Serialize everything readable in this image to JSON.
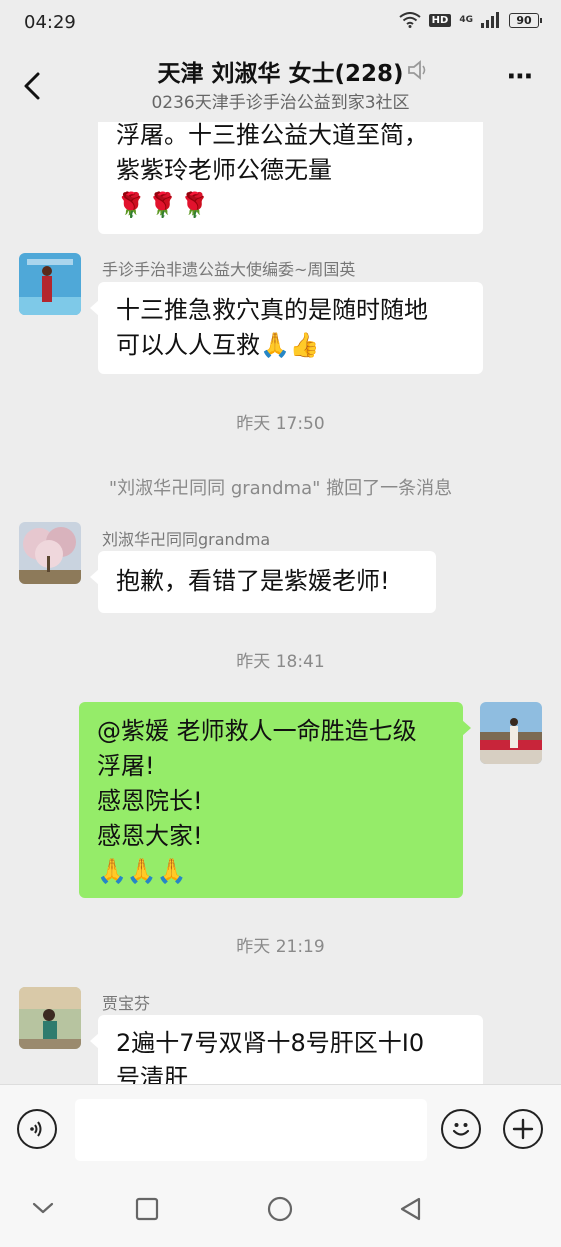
{
  "status_bar": {
    "time": "04:29",
    "hd": "HD",
    "network": "4G",
    "battery": "90"
  },
  "header": {
    "title": "天津 刘淑华 女士(228)",
    "subtitle": "0236天津手诊手治公益到家3社区"
  },
  "messages": {
    "m1": {
      "lines": [
        "浮屠。十三推公益大道至简，",
        "紫紫玲老师公德无量",
        "🌹🌹🌹"
      ]
    },
    "m2": {
      "sender": "手诊手治非遗公益大使编委~周国英",
      "lines": [
        "十三推急救穴真的是随时随地",
        "可以人人互救🙏👍"
      ]
    },
    "t1": "昨天 17:50",
    "recall": "\"刘淑华卍同同 grandma\" 撤回了一条消息",
    "m3": {
      "sender": "刘淑华卍同同grandma",
      "lines": [
        "抱歉，看错了是紫媛老师!"
      ]
    },
    "t2": "昨天 18:41",
    "m4": {
      "lines": [
        "@紫媛  老师救人一命胜造七级",
        "浮屠!",
        "感恩院长!",
        "感恩大家!",
        "🙏🙏🙏"
      ]
    },
    "t3": "昨天 21:19",
    "m5": {
      "sender": "贾宝芬",
      "lines": [
        "2遍十7号双肾十8号肝区十I0",
        "号清肝"
      ]
    }
  },
  "input": {
    "placeholder": ""
  },
  "icons": {
    "back": "back-arrow-icon",
    "mute": "mute-icon",
    "more": "more-icon",
    "voice": "voice-icon",
    "emoji": "emoji-icon",
    "plus": "plus-icon",
    "nav_back": "nav-back-icon",
    "nav_home": "nav-home-icon",
    "nav_recent": "nav-recent-icon"
  },
  "colors": {
    "background": "#ededed",
    "self_bubble": "#95ec69",
    "other_bubble": "#ffffff"
  }
}
